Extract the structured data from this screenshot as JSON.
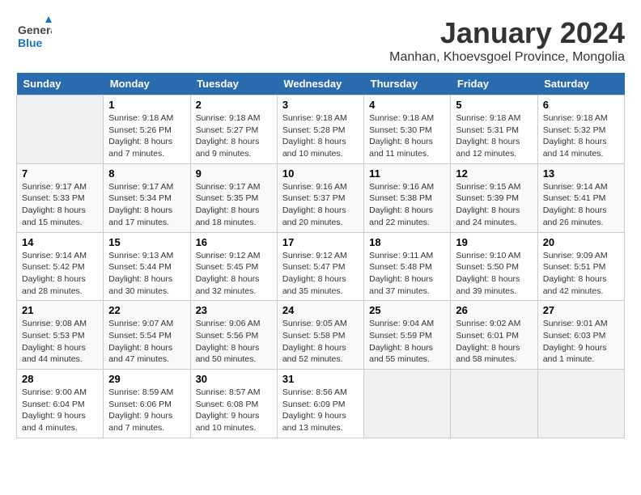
{
  "header": {
    "logo_general": "General",
    "logo_blue": "Blue",
    "title": "January 2024",
    "subtitle": "Manhan, Khoevsgoel Province, Mongolia"
  },
  "calendar": {
    "days_of_week": [
      "Sunday",
      "Monday",
      "Tuesday",
      "Wednesday",
      "Thursday",
      "Friday",
      "Saturday"
    ],
    "weeks": [
      [
        {
          "day": "",
          "info": ""
        },
        {
          "day": "1",
          "info": "Sunrise: 9:18 AM\nSunset: 5:26 PM\nDaylight: 8 hours\nand 7 minutes."
        },
        {
          "day": "2",
          "info": "Sunrise: 9:18 AM\nSunset: 5:27 PM\nDaylight: 8 hours\nand 9 minutes."
        },
        {
          "day": "3",
          "info": "Sunrise: 9:18 AM\nSunset: 5:28 PM\nDaylight: 8 hours\nand 10 minutes."
        },
        {
          "day": "4",
          "info": "Sunrise: 9:18 AM\nSunset: 5:30 PM\nDaylight: 8 hours\nand 11 minutes."
        },
        {
          "day": "5",
          "info": "Sunrise: 9:18 AM\nSunset: 5:31 PM\nDaylight: 8 hours\nand 12 minutes."
        },
        {
          "day": "6",
          "info": "Sunrise: 9:18 AM\nSunset: 5:32 PM\nDaylight: 8 hours\nand 14 minutes."
        }
      ],
      [
        {
          "day": "7",
          "info": "Sunrise: 9:17 AM\nSunset: 5:33 PM\nDaylight: 8 hours\nand 15 minutes."
        },
        {
          "day": "8",
          "info": "Sunrise: 9:17 AM\nSunset: 5:34 PM\nDaylight: 8 hours\nand 17 minutes."
        },
        {
          "day": "9",
          "info": "Sunrise: 9:17 AM\nSunset: 5:35 PM\nDaylight: 8 hours\nand 18 minutes."
        },
        {
          "day": "10",
          "info": "Sunrise: 9:16 AM\nSunset: 5:37 PM\nDaylight: 8 hours\nand 20 minutes."
        },
        {
          "day": "11",
          "info": "Sunrise: 9:16 AM\nSunset: 5:38 PM\nDaylight: 8 hours\nand 22 minutes."
        },
        {
          "day": "12",
          "info": "Sunrise: 9:15 AM\nSunset: 5:39 PM\nDaylight: 8 hours\nand 24 minutes."
        },
        {
          "day": "13",
          "info": "Sunrise: 9:14 AM\nSunset: 5:41 PM\nDaylight: 8 hours\nand 26 minutes."
        }
      ],
      [
        {
          "day": "14",
          "info": "Sunrise: 9:14 AM\nSunset: 5:42 PM\nDaylight: 8 hours\nand 28 minutes."
        },
        {
          "day": "15",
          "info": "Sunrise: 9:13 AM\nSunset: 5:44 PM\nDaylight: 8 hours\nand 30 minutes."
        },
        {
          "day": "16",
          "info": "Sunrise: 9:12 AM\nSunset: 5:45 PM\nDaylight: 8 hours\nand 32 minutes."
        },
        {
          "day": "17",
          "info": "Sunrise: 9:12 AM\nSunset: 5:47 PM\nDaylight: 8 hours\nand 35 minutes."
        },
        {
          "day": "18",
          "info": "Sunrise: 9:11 AM\nSunset: 5:48 PM\nDaylight: 8 hours\nand 37 minutes."
        },
        {
          "day": "19",
          "info": "Sunrise: 9:10 AM\nSunset: 5:50 PM\nDaylight: 8 hours\nand 39 minutes."
        },
        {
          "day": "20",
          "info": "Sunrise: 9:09 AM\nSunset: 5:51 PM\nDaylight: 8 hours\nand 42 minutes."
        }
      ],
      [
        {
          "day": "21",
          "info": "Sunrise: 9:08 AM\nSunset: 5:53 PM\nDaylight: 8 hours\nand 44 minutes."
        },
        {
          "day": "22",
          "info": "Sunrise: 9:07 AM\nSunset: 5:54 PM\nDaylight: 8 hours\nand 47 minutes."
        },
        {
          "day": "23",
          "info": "Sunrise: 9:06 AM\nSunset: 5:56 PM\nDaylight: 8 hours\nand 50 minutes."
        },
        {
          "day": "24",
          "info": "Sunrise: 9:05 AM\nSunset: 5:58 PM\nDaylight: 8 hours\nand 52 minutes."
        },
        {
          "day": "25",
          "info": "Sunrise: 9:04 AM\nSunset: 5:59 PM\nDaylight: 8 hours\nand 55 minutes."
        },
        {
          "day": "26",
          "info": "Sunrise: 9:02 AM\nSunset: 6:01 PM\nDaylight: 8 hours\nand 58 minutes."
        },
        {
          "day": "27",
          "info": "Sunrise: 9:01 AM\nSunset: 6:03 PM\nDaylight: 9 hours\nand 1 minute."
        }
      ],
      [
        {
          "day": "28",
          "info": "Sunrise: 9:00 AM\nSunset: 6:04 PM\nDaylight: 9 hours\nand 4 minutes."
        },
        {
          "day": "29",
          "info": "Sunrise: 8:59 AM\nSunset: 6:06 PM\nDaylight: 9 hours\nand 7 minutes."
        },
        {
          "day": "30",
          "info": "Sunrise: 8:57 AM\nSunset: 6:08 PM\nDaylight: 9 hours\nand 10 minutes."
        },
        {
          "day": "31",
          "info": "Sunrise: 8:56 AM\nSunset: 6:09 PM\nDaylight: 9 hours\nand 13 minutes."
        },
        {
          "day": "",
          "info": ""
        },
        {
          "day": "",
          "info": ""
        },
        {
          "day": "",
          "info": ""
        }
      ]
    ]
  }
}
